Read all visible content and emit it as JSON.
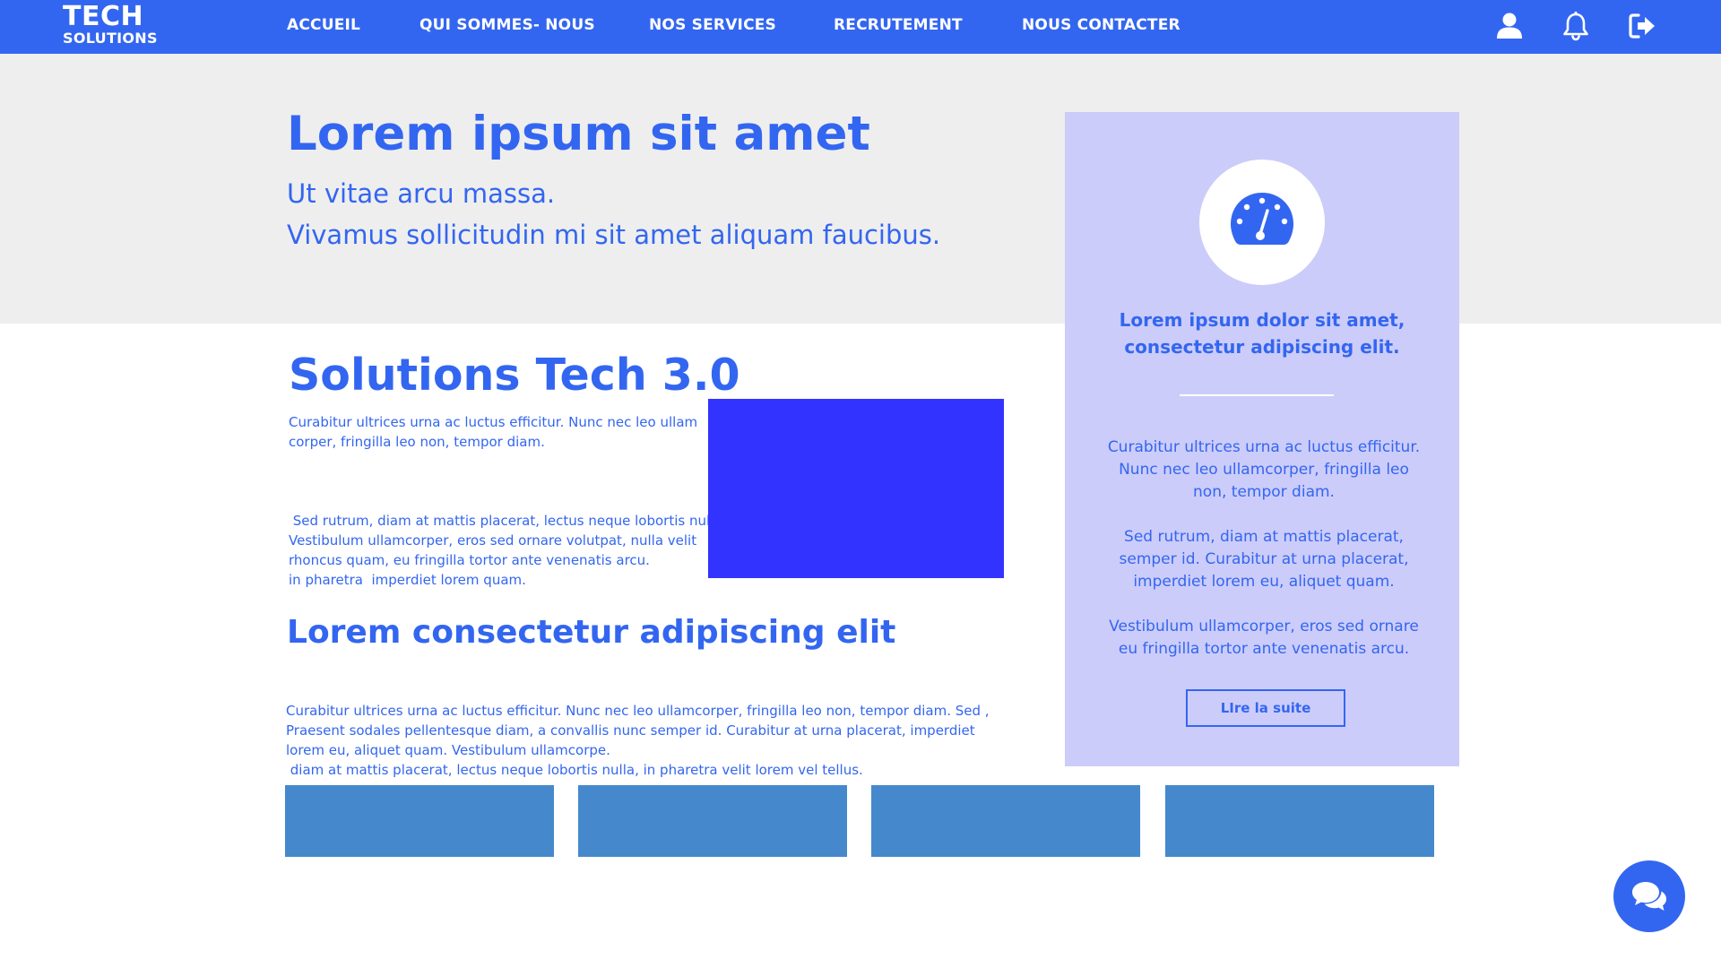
{
  "logo": {
    "line1": "TECH",
    "line2": "SOLUTIONS"
  },
  "nav": {
    "items": [
      {
        "label": "ACCUEIL"
      },
      {
        "label": "QUI SOMMES- NOUS"
      },
      {
        "label": "NOS SERVICES"
      },
      {
        "label": "RECRUTEMENT"
      },
      {
        "label": "NOUS CONTACTER"
      }
    ],
    "icons": [
      "user-icon",
      "bell-icon",
      "sign-out-icon"
    ]
  },
  "hero": {
    "title": "Lorem ipsum sit amet",
    "subtitle_line1": "Ut vitae arcu massa.",
    "subtitle_line2": "Vivamus sollicitudin mi sit amet aliquam faucibus."
  },
  "main": {
    "title": "Solutions Tech 3.0",
    "paragraphs": [
      {
        "line1": "Curabitur ultrices urna ac luctus efficitur. Nunc nec leo ullam",
        "line2": "corper, fringilla leo non, tempor diam."
      },
      {
        "line1": " Sed rutrum, diam at mattis placerat, lectus neque lobortis nulla,",
        "line2": "in pharetra  imperdiet lorem quam."
      },
      {
        "line1": "Vestibulum ullamcorper, eros sed ornare volutpat, nulla velit",
        "line2": "rhoncus quam, eu fringilla tortor ante venenatis arcu."
      }
    ],
    "section2_title": "Lorem consectetur adipiscing elit",
    "section2_paragraphs": [
      {
        "line1": "Curabitur ultrices urna ac luctus efficitur. Nunc nec leo ullamcorper, fringilla leo non, tempor diam. Sed ,",
        "line2": " diam at mattis placerat, lectus neque lobortis nulla, in pharetra velit lorem vel tellus."
      },
      {
        "line1": "Praesent sodales pellentesque diam, a convallis nunc semper id. Curabitur at urna placerat, imperdiet",
        "line2": "lorem eu, aliquet quam. Vestibulum ullamcorpe."
      }
    ]
  },
  "card": {
    "icon": "tachometer-icon",
    "heading_line1": "Lorem ipsum dolor sit amet,",
    "heading_line2": "consectetur adipiscing elit.",
    "paragraphs": [
      {
        "line1": "Curabitur ultrices urna ac luctus efficitur.",
        "line2": "Nunc nec leo ullamcorper, fringilla leo",
        "line3": "non, tempor diam."
      },
      {
        "line1": "Sed rutrum, diam at mattis placerat,",
        "line2": "semper id. Curabitur at urna placerat,",
        "line3": "imperdiet lorem eu, aliquet quam."
      },
      {
        "line1": "Vestibulum ullamcorper, eros sed ornare",
        "line2": "eu fringilla tortor ante venenatis arcu."
      }
    ],
    "button_label": "LIre la suite"
  },
  "chat": {
    "icon": "comments-icon"
  },
  "colors": {
    "primary": "#3366f0",
    "hero_bg": "#eeeeee",
    "card_bg": "#ccccfa",
    "media_block": "#3333ff",
    "tile": "#4589cc"
  }
}
